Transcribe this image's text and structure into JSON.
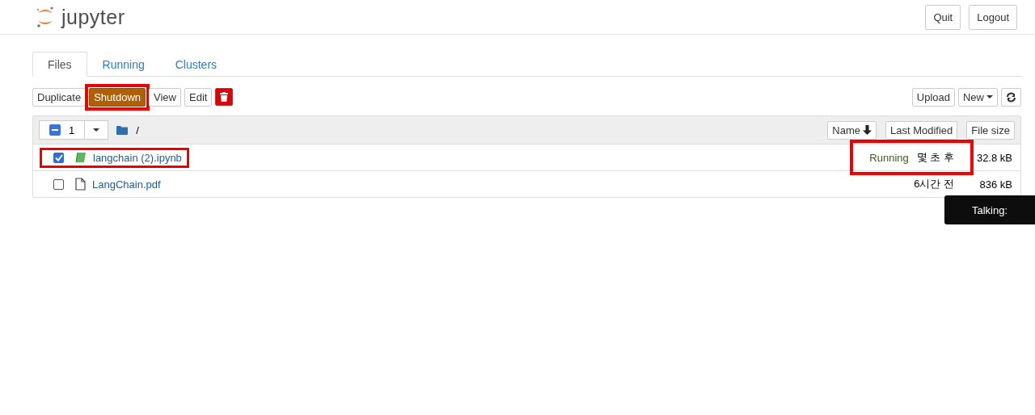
{
  "header": {
    "logo_text": "jupyter",
    "buttons": [
      "Quit",
      "Logout"
    ]
  },
  "tabs": [
    {
      "label": "Files",
      "selected": true
    },
    {
      "label": "Running",
      "selected": false
    },
    {
      "label": "Clusters",
      "selected": false
    }
  ],
  "toolbar": {
    "actions": [
      {
        "label": "Duplicate",
        "kind": "default",
        "highlighted": false
      },
      {
        "label": "Shutdown",
        "kind": "warning",
        "highlighted": true
      },
      {
        "label": "View",
        "kind": "default",
        "highlighted": false
      },
      {
        "label": "Edit",
        "kind": "default",
        "highlighted": false
      },
      {
        "kind": "delete",
        "highlighted": false
      }
    ],
    "upload": "Upload",
    "new": "New"
  },
  "list_header": {
    "selected_count": "1",
    "path": "/",
    "columns": [
      "Name",
      "Last Modified",
      "File size"
    ]
  },
  "rows": [
    {
      "name": "langchain (2).ipynb",
      "kind": "notebook",
      "checked": true,
      "running": "Running",
      "modified": "몇 초 후",
      "size": "32.8 kB",
      "name_highlighted": true,
      "status_highlighted": true
    },
    {
      "name": "LangChain.pdf",
      "kind": "file",
      "checked": false,
      "modified": "6시간 전",
      "size": "836 kB",
      "name_highlighted": false,
      "status_highlighted": false
    }
  ],
  "tooltip": "Talking:"
}
